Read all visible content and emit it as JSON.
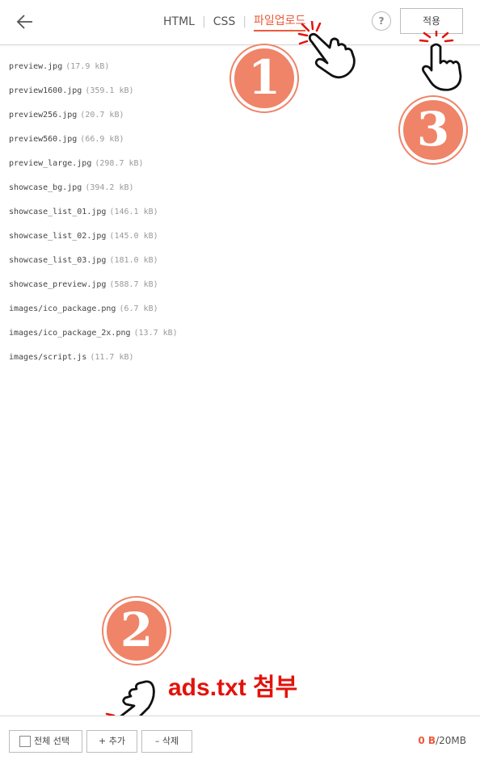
{
  "header": {
    "tabs": [
      {
        "label": "HTML",
        "active": false
      },
      {
        "label": "CSS",
        "active": false
      },
      {
        "label": "파일업로드",
        "active": true
      }
    ],
    "help_label": "?",
    "apply_label": "적용"
  },
  "files": [
    {
      "name": "preview.jpg",
      "size": "(17.9 kB)"
    },
    {
      "name": "preview1600.jpg",
      "size": "(359.1 kB)"
    },
    {
      "name": "preview256.jpg",
      "size": "(20.7 kB)"
    },
    {
      "name": "preview560.jpg",
      "size": "(66.9 kB)"
    },
    {
      "name": "preview_large.jpg",
      "size": "(298.7 kB)"
    },
    {
      "name": "showcase_bg.jpg",
      "size": "(394.2 kB)"
    },
    {
      "name": "showcase_list_01.jpg",
      "size": "(146.1 kB)"
    },
    {
      "name": "showcase_list_02.jpg",
      "size": "(145.0 kB)"
    },
    {
      "name": "showcase_list_03.jpg",
      "size": "(181.0 kB)"
    },
    {
      "name": "showcase_preview.jpg",
      "size": "(588.7 kB)"
    },
    {
      "name": "images/ico_package.png",
      "size": "(6.7 kB)"
    },
    {
      "name": "images/ico_package_2x.png",
      "size": "(13.7 kB)"
    },
    {
      "name": "images/script.js",
      "size": "(11.7 kB)"
    }
  ],
  "badges": {
    "one": "1",
    "two": "2",
    "three": "3"
  },
  "annotation": "ads.txt 첨부",
  "footer": {
    "select_all": "전체 선택",
    "add": "+ 추가",
    "delete": "– 삭제",
    "used": "0 B",
    "separator": "/",
    "limit": "20MB"
  },
  "colors": {
    "accent": "#ea5a3b",
    "badge": "#ef8468",
    "annotation": "#e3120b"
  }
}
